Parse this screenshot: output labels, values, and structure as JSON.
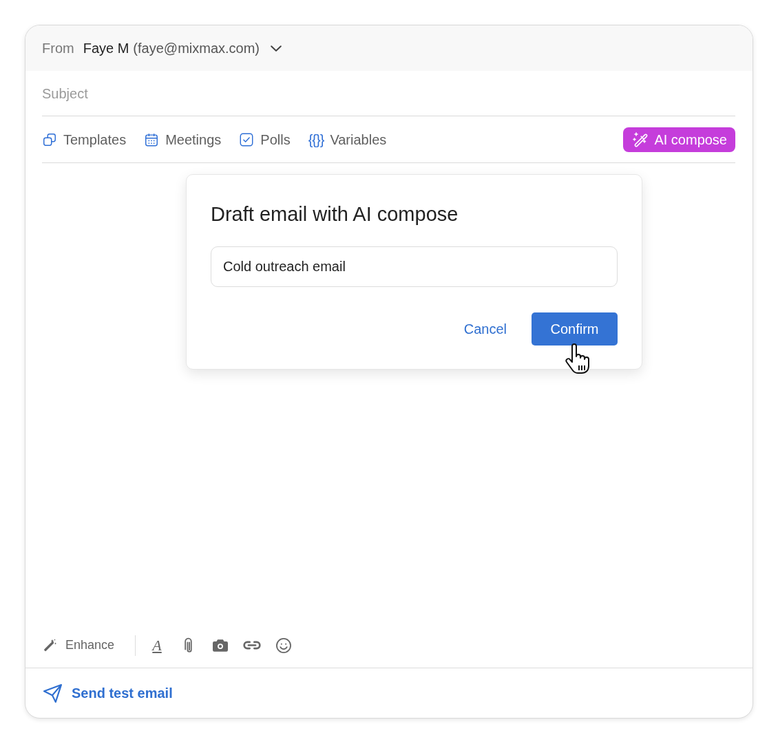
{
  "sender": {
    "label": "From",
    "name": "Faye M",
    "address": "(faye@mixmax.com)"
  },
  "subject": {
    "placeholder": "Subject"
  },
  "toolbar": {
    "items": [
      {
        "kind": "templates",
        "label": "Templates"
      },
      {
        "kind": "meetings",
        "label": "Meetings"
      },
      {
        "kind": "polls",
        "label": "Polls"
      },
      {
        "kind": "variables",
        "glyph": "{{}}",
        "label": "Variables"
      }
    ],
    "ai_compose": {
      "label": "AI compose"
    }
  },
  "dialog": {
    "title": "Draft email with AI compose",
    "input": {
      "value": "Cold outreach email"
    },
    "buttons": [
      {
        "kind": "link",
        "label": "Cancel"
      },
      {
        "kind": "primary",
        "label": "Confirm"
      }
    ]
  },
  "format_bar": {
    "enhance": {
      "label": "Enhance"
    },
    "tools": [
      {
        "kind": "text-format",
        "glyph": "A"
      },
      {
        "kind": "attachment"
      },
      {
        "kind": "photo"
      },
      {
        "kind": "link"
      },
      {
        "kind": "emoji"
      }
    ]
  },
  "footer": {
    "send_test": {
      "label": "Send test email"
    }
  }
}
